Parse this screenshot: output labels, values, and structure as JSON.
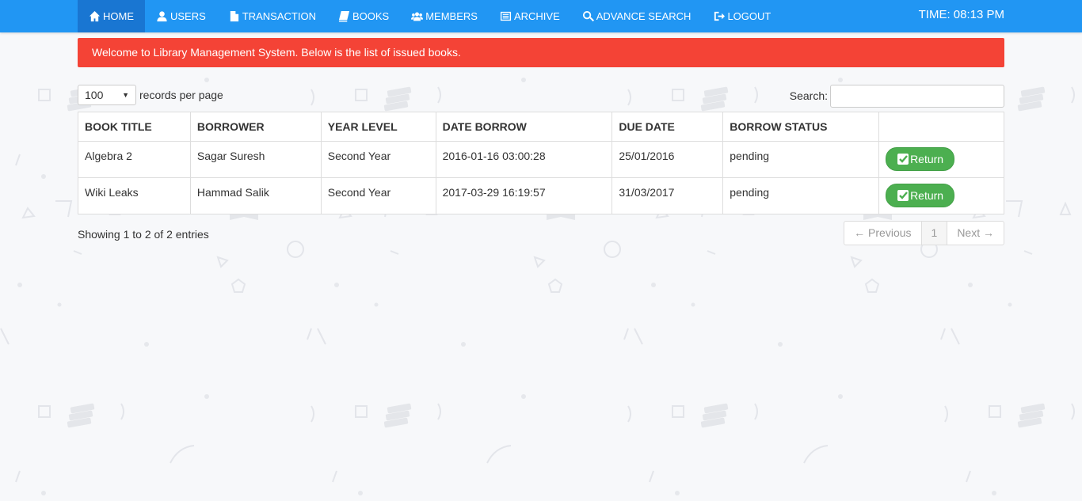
{
  "nav": {
    "items": [
      {
        "label": "HOME",
        "icon": "home-icon"
      },
      {
        "label": "USERS",
        "icon": "user-icon"
      },
      {
        "label": "TRANSACTION",
        "icon": "file-icon"
      },
      {
        "label": "BOOKS",
        "icon": "book-icon"
      },
      {
        "label": "MEMBERS",
        "icon": "group-icon"
      },
      {
        "label": "ARCHIVE",
        "icon": "list-icon"
      },
      {
        "label": "ADVANCE SEARCH",
        "icon": "search-icon"
      },
      {
        "label": "LOGOUT",
        "icon": "logout-icon"
      }
    ],
    "time": "TIME: 08:13 PM"
  },
  "alert": {
    "message": "Welcome to Library Management System. Below is the list of issued books."
  },
  "table_controls": {
    "length_value": "100",
    "length_suffix": "records per page",
    "search_label": "Search:",
    "search_value": ""
  },
  "table": {
    "headers": [
      "BOOK TITLE",
      "BORROWER",
      "YEAR LEVEL",
      "DATE BORROW",
      "DUE DATE",
      "BORROW STATUS",
      ""
    ],
    "rows": [
      {
        "book_title": "Algebra 2",
        "borrower": "Sagar Suresh",
        "year_level": "Second Year",
        "date_borrow": "2016-01-16 03:00:28",
        "due_date": "25/01/2016",
        "status": "pending",
        "action": "Return"
      },
      {
        "book_title": "Wiki Leaks",
        "borrower": "Hammad Salik",
        "year_level": "Second Year",
        "date_borrow": "2017-03-29 16:19:57",
        "due_date": "31/03/2017",
        "status": "pending",
        "action": "Return"
      }
    ]
  },
  "footer": {
    "info": "Showing 1 to 2 of 2 entries",
    "prev_label": "← Previous",
    "page": "1",
    "next_label": "Next →"
  },
  "colors": {
    "navbar": "#2196f3",
    "nav_active": "#1976d2",
    "alert": "#f44336",
    "button_return": "#4caf50",
    "background": "#f7f8fa"
  }
}
